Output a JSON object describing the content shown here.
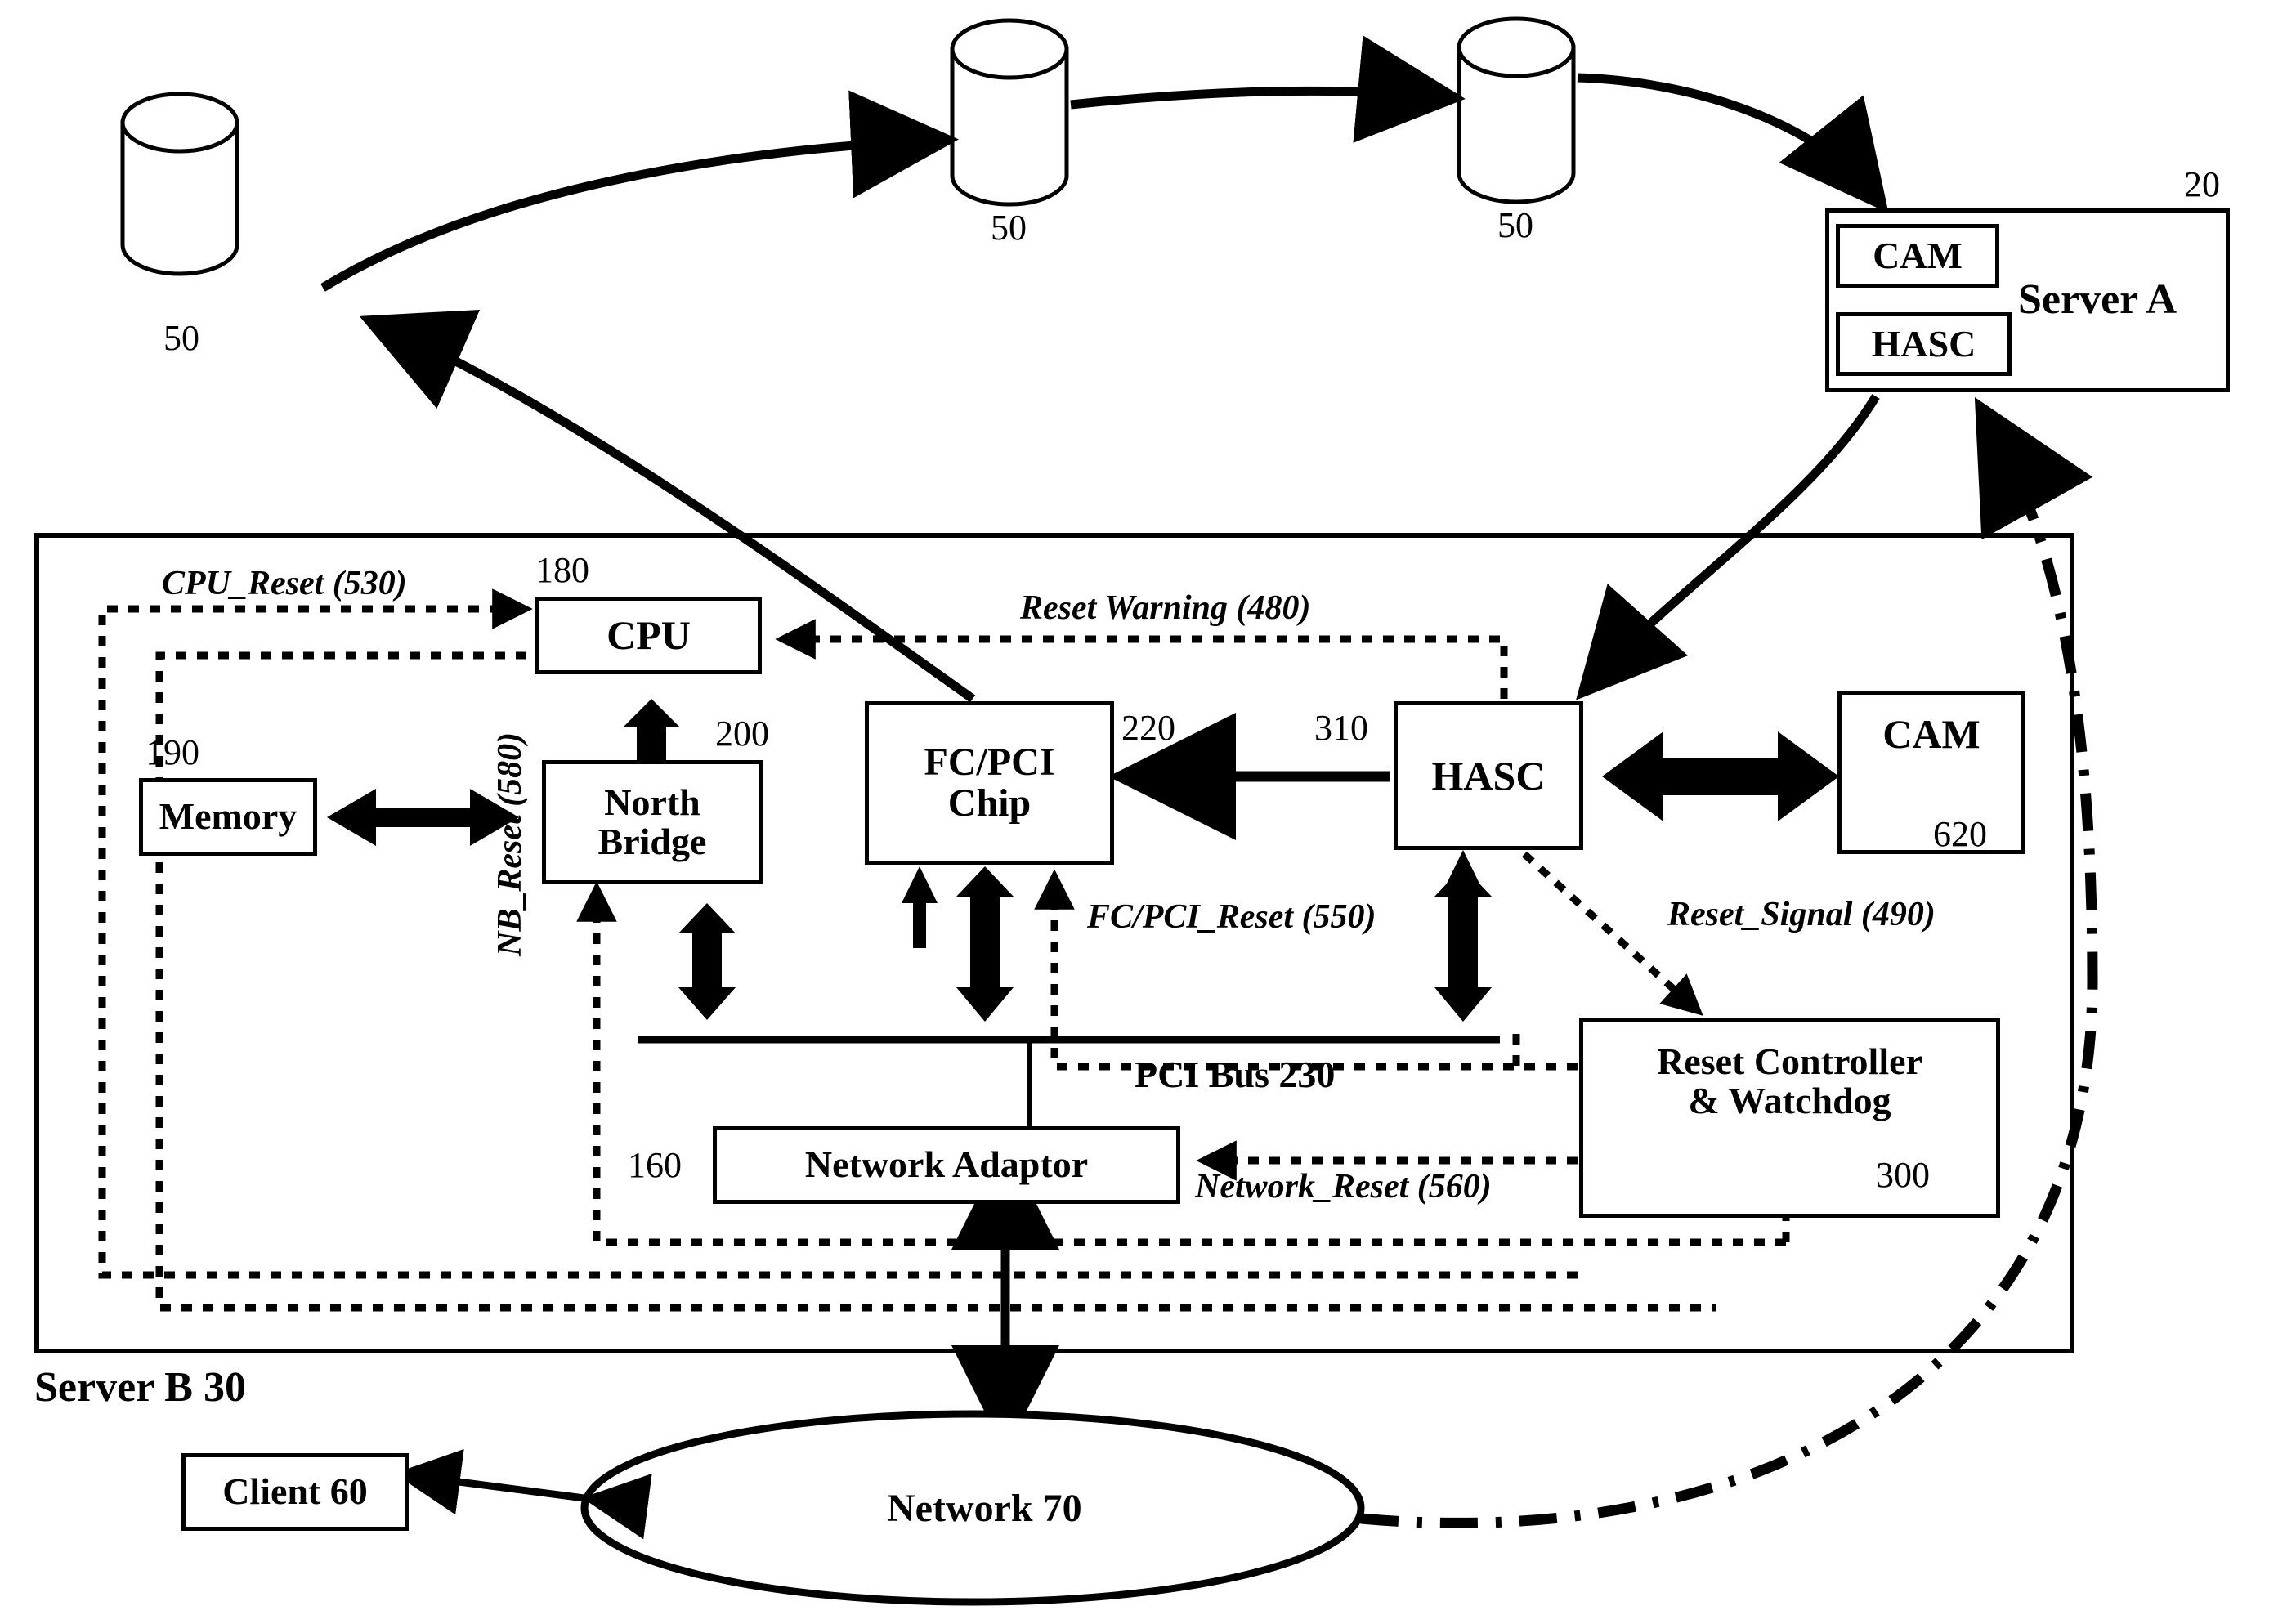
{
  "diagram": {
    "title_note": "Server A / Server B high-availability reset architecture",
    "storage_cylinders": [
      {
        "label": "50"
      },
      {
        "label": "50"
      },
      {
        "label": "50"
      }
    ],
    "server_a": {
      "name": "Server A",
      "ref": "20",
      "sub_blocks": [
        {
          "name": "CAM"
        },
        {
          "name": "HASC"
        }
      ]
    },
    "server_b": {
      "name": "Server B",
      "ref": "30",
      "blocks": [
        {
          "key": "cpu",
          "name": "CPU",
          "ref": "180"
        },
        {
          "key": "memory",
          "name": "Memory",
          "ref": "190"
        },
        {
          "key": "north_bridge",
          "name": "North Bridge",
          "ref": "200"
        },
        {
          "key": "fcpci",
          "name": "FC/PCI Chip",
          "ref": "220"
        },
        {
          "key": "hasc",
          "name": "HASC",
          "ref": "310"
        },
        {
          "key": "cam",
          "name": "CAM",
          "ref": "620"
        },
        {
          "key": "reset_controller",
          "name": "Reset Controller & Watchdog",
          "ref": "300"
        },
        {
          "key": "network_adaptor",
          "name": "Network Adaptor",
          "ref": "160"
        }
      ],
      "bus": {
        "name": "PCI Bus",
        "ref": "230"
      },
      "signals": [
        {
          "key": "cpu_reset",
          "label": "CPU_Reset (530)"
        },
        {
          "key": "reset_warning",
          "label": "Reset  Warning (480)"
        },
        {
          "key": "fcpci_reset",
          "label": "FC/PCI_Reset (550)"
        },
        {
          "key": "reset_signal",
          "label": "Reset_Signal (490)"
        },
        {
          "key": "network_reset",
          "label": "Network_Reset (560)"
        },
        {
          "key": "nb_reset",
          "label": "NB_Reset (580)"
        }
      ]
    },
    "client": {
      "name": "Client",
      "ref": "60"
    },
    "network": {
      "name": "Network",
      "ref": "70"
    },
    "labels": {
      "cpu_box": "CPU",
      "memory_box": "Memory",
      "north_bridge_line1": "North",
      "north_bridge_line2": "Bridge",
      "fcpci_line1": "FC/PCI",
      "fcpci_line2": "Chip",
      "hasc_box": "HASC",
      "cam_box": "CAM",
      "rc_line1": "Reset Controller",
      "rc_line2": "& Watchdog",
      "na_box": "Network Adaptor",
      "pci_bus": "PCI Bus  230",
      "server_a_box": "Server A",
      "server_a_cam": "CAM",
      "server_a_hasc": "HASC",
      "server_b_caption": "Server B 30",
      "client_box": "Client 60",
      "network_ellipse": "Network 70",
      "ref_20": "20",
      "ref_180": "180",
      "ref_190": "190",
      "ref_200": "200",
      "ref_220": "220",
      "ref_310": "310",
      "ref_620": "620",
      "ref_300": "300",
      "ref_160": "160",
      "cyl1": "50",
      "cyl2": "50",
      "cyl3": "50"
    },
    "colors": {
      "stroke": "#000000",
      "fill": "#ffffff"
    }
  }
}
